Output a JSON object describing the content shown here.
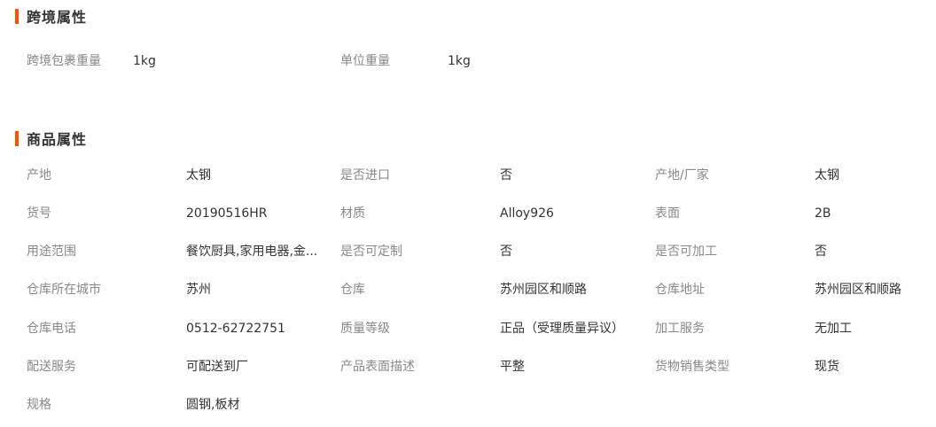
{
  "cross_border": {
    "title": "跨境属性",
    "items": [
      {
        "label": "跨境包裹重量",
        "value": "1kg"
      },
      {
        "label": "单位重量",
        "value": "1kg"
      }
    ]
  },
  "product": {
    "title": "商品属性",
    "rows": [
      [
        {
          "label": "产地",
          "value": "太钢"
        },
        {
          "label": "是否进口",
          "value": "否"
        },
        {
          "label": "产地/厂家",
          "value": "太钢"
        }
      ],
      [
        {
          "label": "货号",
          "value": "20190516HR"
        },
        {
          "label": "材质",
          "value": "Alloy926"
        },
        {
          "label": "表面",
          "value": "2B"
        }
      ],
      [
        {
          "label": "用途范围",
          "value": "餐饮厨具,家用电器,金..."
        },
        {
          "label": "是否可定制",
          "value": "否"
        },
        {
          "label": "是否可加工",
          "value": "否"
        }
      ],
      [
        {
          "label": "仓库所在城市",
          "value": "苏州"
        },
        {
          "label": "仓库",
          "value": "苏州园区和顺路"
        },
        {
          "label": "仓库地址",
          "value": "苏州园区和顺路"
        }
      ],
      [
        {
          "label": "仓库电话",
          "value": "0512-62722751"
        },
        {
          "label": "质量等级",
          "value": "正品（受理质量异议）"
        },
        {
          "label": "加工服务",
          "value": "无加工"
        }
      ],
      [
        {
          "label": "配送服务",
          "value": "可配送到厂"
        },
        {
          "label": "产品表面描述",
          "value": "平整"
        },
        {
          "label": "货物销售类型",
          "value": "现货"
        }
      ],
      [
        {
          "label": "规格",
          "value": "圆钢,板材"
        }
      ]
    ]
  }
}
